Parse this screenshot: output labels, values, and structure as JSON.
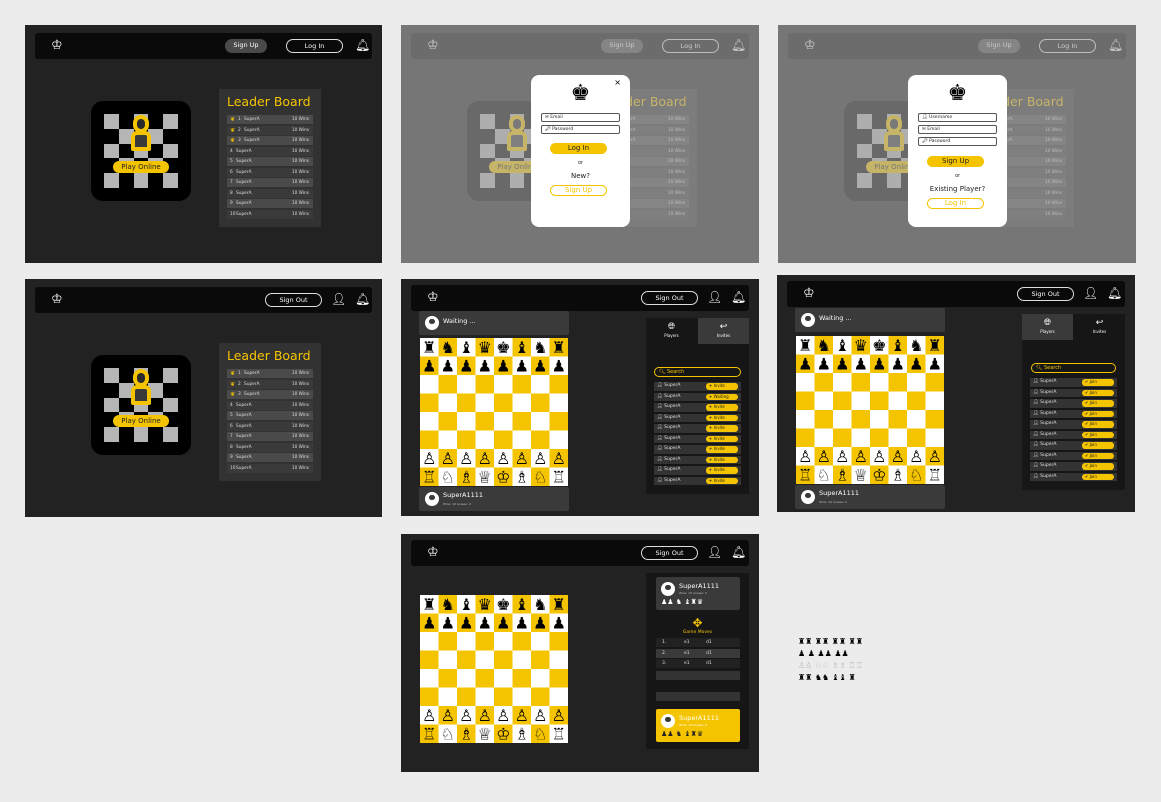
{
  "colors": {
    "accent": "#f5c400",
    "frame": "#222222",
    "navbar": "#0a0a0a",
    "light_square": "#ffffff"
  },
  "nav": {
    "sign_up": "Sign Up",
    "log_in": "Log In",
    "sign_out": "Sign Out",
    "logo_icon": "crown-icon",
    "bell_icon": "bell-icon",
    "user_icon": "user-icon"
  },
  "home": {
    "play_online": "Play Online"
  },
  "leaderboard": {
    "title": "Leader Board",
    "rows": [
      {
        "rank": "1",
        "name": "SuperA",
        "wins": "10 Wins"
      },
      {
        "rank": "2",
        "name": "SuperA",
        "wins": "10 Wins"
      },
      {
        "rank": "3",
        "name": "SuperA",
        "wins": "10 Wins"
      },
      {
        "rank": "4",
        "name": "SuperA",
        "wins": "10 Wins"
      },
      {
        "rank": "5",
        "name": "SuperA",
        "wins": "10 Wins"
      },
      {
        "rank": "6",
        "name": "SuperA",
        "wins": "10 Wins"
      },
      {
        "rank": "7",
        "name": "SuperA",
        "wins": "10 Wins"
      },
      {
        "rank": "8",
        "name": "SuperA",
        "wins": "10 Wins"
      },
      {
        "rank": "9",
        "name": "SuperA",
        "wins": "10 Wins"
      },
      {
        "rank": "10",
        "name": "SuperA",
        "wins": "10 Wins"
      }
    ]
  },
  "login_modal": {
    "email_placeholder": "Email",
    "password_placeholder": "Password",
    "login_label": "Log In",
    "or": "or",
    "new_prompt": "New?",
    "signup_label": "Sign Up",
    "close": "×"
  },
  "signup_modal": {
    "username_placeholder": "Username",
    "email_placeholder": "Email",
    "password_placeholder": "Password",
    "signup_label": "Sign Up",
    "or": "or",
    "existing_prompt": "Existing Player?",
    "login_label": "Log In"
  },
  "game": {
    "waiting": "Waiting ...",
    "player_name": "SuperA1111",
    "player_stats": "Wins: 10    Losses: 0",
    "players_tab": "Players",
    "invites_tab": "Invites",
    "search_placeholder": "Search",
    "invite_list": [
      {
        "name": "SuperA",
        "action": "Invite"
      },
      {
        "name": "SuperA",
        "action": "Waiting"
      },
      {
        "name": "SuperA",
        "action": "Invite"
      },
      {
        "name": "SuperA",
        "action": "Invite"
      },
      {
        "name": "SuperA",
        "action": "Invite"
      },
      {
        "name": "SuperA",
        "action": "Invite"
      },
      {
        "name": "SuperA",
        "action": "Invite"
      },
      {
        "name": "SuperA",
        "action": "Invite"
      },
      {
        "name": "SuperA",
        "action": "Invite"
      },
      {
        "name": "SuperA",
        "action": "Invite"
      }
    ],
    "join_list": [
      {
        "name": "SuperA",
        "action": "Join"
      },
      {
        "name": "SuperA",
        "action": "Join"
      },
      {
        "name": "SuperA",
        "action": "Join"
      },
      {
        "name": "SuperA",
        "action": "Join"
      },
      {
        "name": "SuperA",
        "action": "Join"
      },
      {
        "name": "SuperA",
        "action": "Join"
      },
      {
        "name": "SuperA",
        "action": "Join"
      },
      {
        "name": "SuperA",
        "action": "Join"
      },
      {
        "name": "SuperA",
        "action": "Join"
      },
      {
        "name": "SuperA",
        "action": "Join"
      }
    ]
  },
  "match": {
    "opponent": "SuperA1111",
    "opponent_stats": "Wins: 10    Losses: 0",
    "captured_top": "♟♟ ♞ ♝♜♛",
    "game_moves_label": "Game Moves",
    "moves": [
      {
        "n": "1.",
        "w": "e1",
        "b": "d1"
      },
      {
        "n": "2.",
        "w": "e1",
        "b": "d1"
      },
      {
        "n": "3.",
        "w": "e1",
        "b": "d1"
      }
    ],
    "self": "SuperA1111",
    "self_stats": "Wins: 10    Losses: 0",
    "captured_bottom": "♟♟ ♞ ♝♜♛"
  },
  "sprites": {
    "line1": "♜♜ ♜♜ ♜♜ ♜♜",
    "line2": "♟ ♟ ♟♟ ♟♟",
    "line3": "♙♙ ♘♘ ♗♗ ♖♖",
    "line4": "♜♜ ♞♞ ♝♝ ♜"
  }
}
